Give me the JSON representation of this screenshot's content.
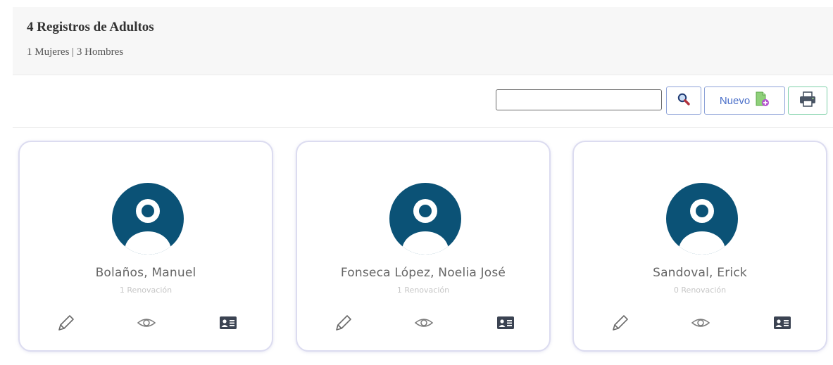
{
  "header": {
    "title": "4 Registros de Adultos",
    "subtitle": "1 Mujeres | 3 Hombres"
  },
  "toolbar": {
    "search_value": "",
    "new_label": "Nuevo",
    "search_icon": "magnifier-icon",
    "new_icon": "new-document-icon",
    "print_icon": "printer-icon"
  },
  "cards": [
    {
      "name": "Bolaños, Manuel",
      "subtitle": "1 Renovación"
    },
    {
      "name": "Fonseca López, Noelia José",
      "subtitle": "1 Renovación"
    },
    {
      "name": "Sandoval, Erick",
      "subtitle": "0 Renovación"
    }
  ],
  "colors": {
    "avatar": "#0b5276",
    "button_blue_border": "#8ea3d8",
    "button_green_border": "#7ed0a8",
    "card_border": "#dcdcf0"
  }
}
